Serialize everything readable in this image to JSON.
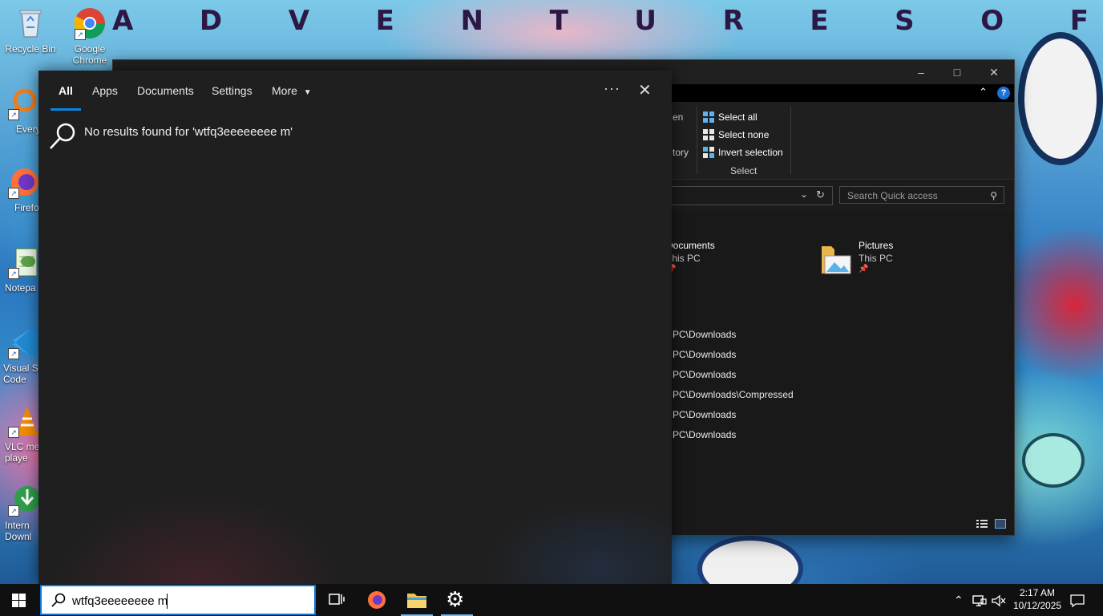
{
  "wallpaper": {
    "letters": [
      "A",
      "D",
      "V",
      "E",
      "N",
      "T",
      "U",
      "R",
      "E",
      "S",
      "O",
      "F"
    ]
  },
  "desktop_icons": [
    {
      "label": "Recycle Bin",
      "icon": "recycle-bin-icon"
    },
    {
      "label": "Google Chrome",
      "icon": "chrome-icon"
    },
    {
      "label": "Everyth",
      "icon": "everything-search-icon"
    },
    {
      "label": "Firefo",
      "icon": "firefox-icon"
    },
    {
      "label": "Notepa",
      "icon": "notepad-icon"
    },
    {
      "label": "Visual St Code",
      "icon": "vscode-icon"
    },
    {
      "label": "VLC me playe",
      "icon": "vlc-icon"
    },
    {
      "label": "Intern Downl",
      "icon": "internet-download-manager-icon"
    }
  ],
  "explorer": {
    "select_group": {
      "label": "Select",
      "items": [
        "Select all",
        "Select none",
        "Invert selection"
      ],
      "partial_left": [
        "en",
        "tory"
      ]
    },
    "search_placeholder": "Search Quick access",
    "quick_access": [
      {
        "name": "Documents",
        "location": "This PC"
      },
      {
        "name": "Pictures",
        "location": "This PC"
      }
    ],
    "recent_paths": [
      "PC\\Downloads",
      "PC\\Downloads",
      "PC\\Downloads",
      "PC\\Downloads\\Compressed",
      "PC\\Downloads",
      "PC\\Downloads"
    ]
  },
  "search_panel": {
    "tabs": [
      "All",
      "Apps",
      "Documents",
      "Settings",
      "More"
    ],
    "active_tab": "All",
    "message": "No results found for 'wtfq3eeeeeeee m'"
  },
  "taskbar": {
    "search_query": "wtfq3eeeeeeee m",
    "time": "2:17 AM",
    "date": "10/12/2025"
  },
  "colors": {
    "accent": "#0a84e0",
    "panel_bg": "#1f1f1f",
    "taskbar_bg": "#101010"
  }
}
